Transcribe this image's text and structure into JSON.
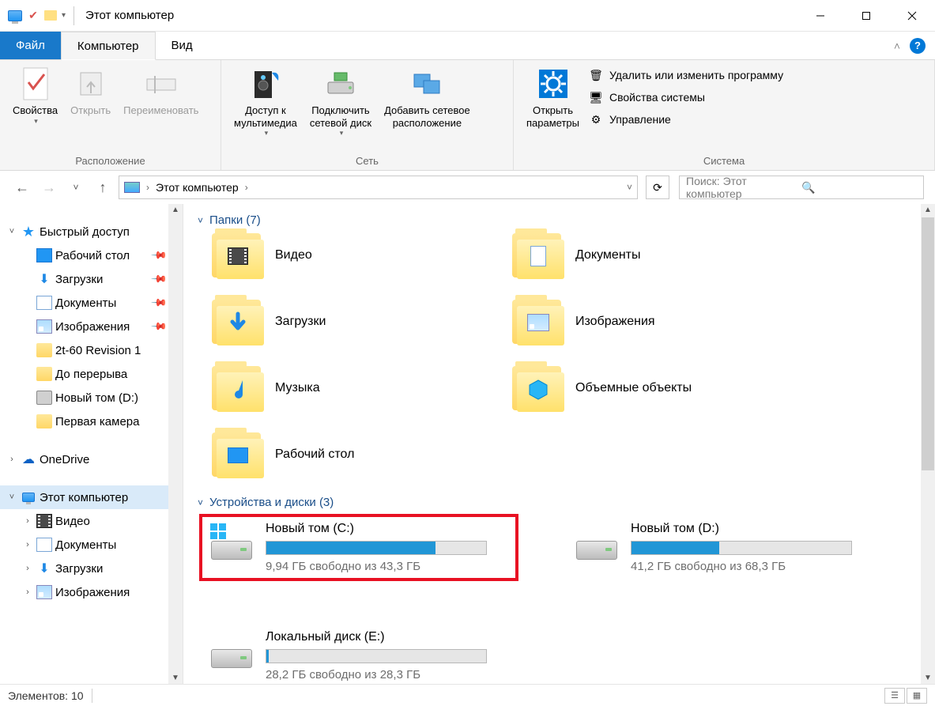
{
  "window": {
    "title": "Этот компьютер"
  },
  "tabs": {
    "file": "Файл",
    "computer": "Компьютер",
    "view": "Вид"
  },
  "ribbon": {
    "location": {
      "properties": "Свойства",
      "open": "Открыть",
      "rename": "Переименовать",
      "group_label": "Расположение"
    },
    "network": {
      "media": "Доступ к\nмультимедиа",
      "map_drive": "Подключить\nсетевой диск",
      "add_location": "Добавить сетевое\nрасположение",
      "group_label": "Сеть"
    },
    "system": {
      "open_settings": "Открыть\nпараметры",
      "uninstall": "Удалить или изменить программу",
      "system_properties": "Свойства системы",
      "manage": "Управление",
      "group_label": "Система"
    }
  },
  "address_bar": {
    "location": "Этот компьютер",
    "search_placeholder": "Поиск: Этот компьютер"
  },
  "tree": {
    "quick_access": "Быстрый доступ",
    "desktop": "Рабочий стол",
    "downloads": "Загрузки",
    "documents": "Документы",
    "pictures": "Изображения",
    "custom1": "2t-60 Revision 1",
    "custom2": "До перерыва",
    "custom3": "Новый том (D:)",
    "custom4": "Первая камера",
    "onedrive": "OneDrive",
    "this_pc": "Этот компьютер",
    "video": "Видео",
    "documents2": "Документы",
    "downloads2": "Загрузки",
    "pictures2": "Изображения"
  },
  "sections": {
    "folders_header": "Папки (7)",
    "drives_header": "Устройства и диски (3)"
  },
  "folders": {
    "video": "Видео",
    "documents": "Документы",
    "downloads": "Загрузки",
    "pictures": "Изображения",
    "music": "Музыка",
    "objects3d": "Объемные объекты",
    "desktop": "Рабочий стол"
  },
  "drives": [
    {
      "name": "Новый том (C:)",
      "free_text": "9,94 ГБ свободно из 43,3 ГБ",
      "fill_pct": 77,
      "highlighted": true,
      "os": true
    },
    {
      "name": "Новый том (D:)",
      "free_text": "41,2 ГБ свободно из 68,3 ГБ",
      "fill_pct": 40,
      "highlighted": false,
      "os": false
    },
    {
      "name": "Локальный диск (E:)",
      "free_text": "28,2 ГБ свободно из 28,3 ГБ",
      "fill_pct": 1,
      "highlighted": false,
      "os": false
    }
  ],
  "status_bar": {
    "items": "Элементов: 10"
  }
}
